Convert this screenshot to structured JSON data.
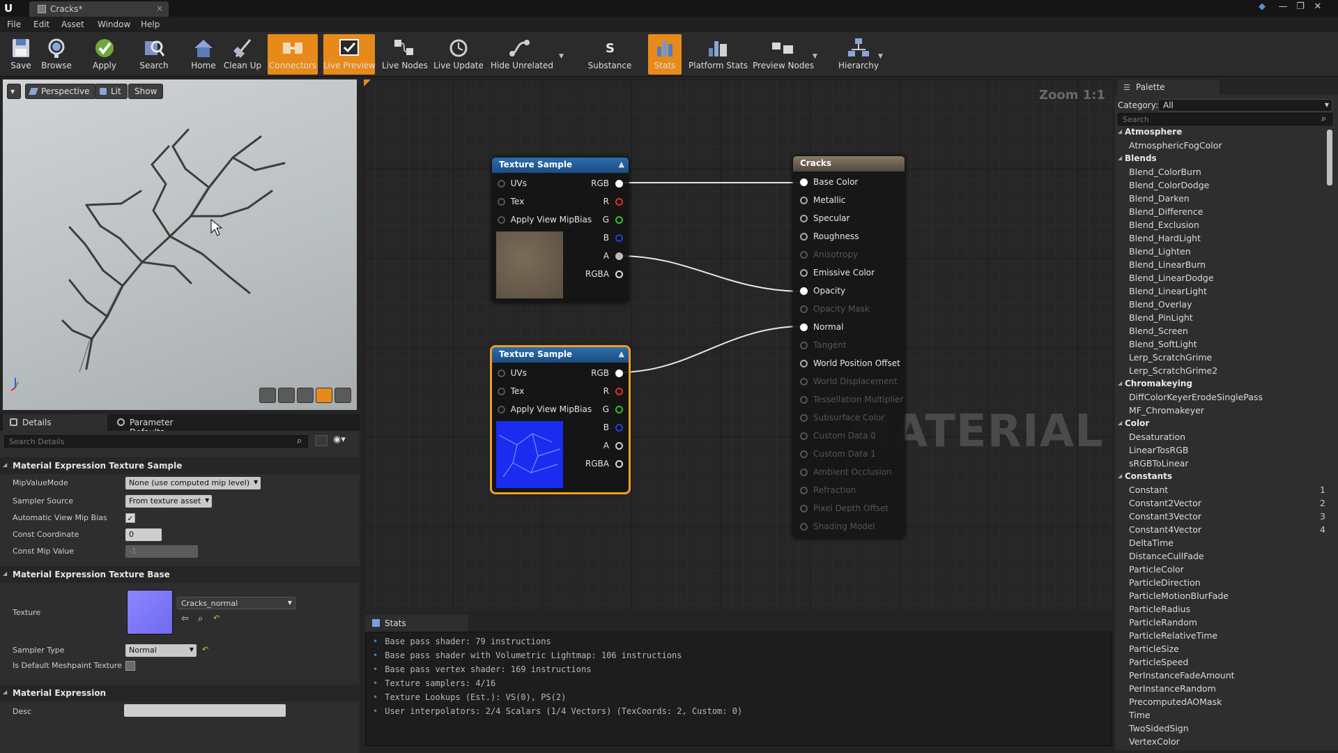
{
  "window": {
    "tab_title": "Cracks*",
    "controls": [
      "—",
      "❐",
      "✕"
    ]
  },
  "menu": [
    "File",
    "Edit",
    "Asset",
    "Window",
    "Help"
  ],
  "toolbar": [
    {
      "label": "Save",
      "icon": "save-icon",
      "active": false
    },
    {
      "label": "Browse",
      "icon": "browse-icon",
      "active": false
    },
    {
      "label": "Apply",
      "icon": "apply-icon",
      "active": false
    },
    {
      "label": "Search",
      "icon": "search-icon",
      "active": false
    },
    {
      "label": "Home",
      "icon": "home-icon",
      "active": false
    },
    {
      "label": "Clean Up",
      "icon": "clean-up-icon",
      "active": false
    },
    {
      "label": "Connectors",
      "icon": "connectors-icon",
      "active": true
    },
    {
      "label": "Live Preview",
      "icon": "live-preview-icon",
      "active": true
    },
    {
      "label": "Live Nodes",
      "icon": "live-nodes-icon",
      "active": false
    },
    {
      "label": "Live Update",
      "icon": "live-update-icon",
      "active": false
    },
    {
      "label": "Hide Unrelated",
      "icon": "hide-unrelated-icon",
      "active": false
    },
    {
      "label": "Substance",
      "icon": "substance-icon",
      "active": false
    },
    {
      "label": "Stats",
      "icon": "stats-icon",
      "active": true
    },
    {
      "label": "Platform Stats",
      "icon": "platform-stats-icon",
      "active": false
    },
    {
      "label": "Preview Nodes",
      "icon": "preview-nodes-icon",
      "active": false
    },
    {
      "label": "Hierarchy",
      "icon": "hierarchy-icon",
      "active": false
    }
  ],
  "viewport": {
    "perspective": "Perspective",
    "lit": "Lit",
    "show": "Show"
  },
  "details": {
    "tabs": [
      "Details",
      "Parameter Defaults"
    ],
    "search_placeholder": "Search Details",
    "section1": "Material Expression Texture Sample",
    "mip_value_mode_label": "MipValueMode",
    "mip_value_mode": "None (use computed mip level)",
    "sampler_source_label": "Sampler Source",
    "sampler_source": "From texture asset",
    "auto_mip_label": "Automatic View Mip Bias",
    "auto_mip_checked": true,
    "const_coord_label": "Const Coordinate",
    "const_coord": "0",
    "const_mip_label": "Const Mip Value",
    "const_mip": "-1",
    "section2": "Material Expression Texture Base",
    "texture_label": "Texture",
    "texture": "Cracks_normal",
    "sampler_type_label": "Sampler Type",
    "sampler_type": "Normal",
    "default_meshpaint_label": "Is Default Meshpaint Texture",
    "default_meshpaint_checked": false,
    "section3": "Material Expression",
    "desc_label": "Desc",
    "desc": ""
  },
  "graph": {
    "zoom": "Zoom 1:1",
    "watermark": "MATERIAL",
    "node1": {
      "title": "Texture Sample",
      "inputs": [
        "UVs",
        "Tex",
        "Apply View MipBias"
      ],
      "outputs": [
        "RGB",
        "R",
        "G",
        "B",
        "A",
        "RGBA"
      ]
    },
    "node2": {
      "title": "Texture Sample",
      "inputs": [
        "UVs",
        "Tex",
        "Apply View MipBias"
      ],
      "outputs": [
        "RGB",
        "R",
        "G",
        "B",
        "A",
        "RGBA"
      ]
    },
    "result": {
      "title": "Cracks",
      "pins": [
        {
          "label": "Base Color",
          "enabled": true,
          "connected": true
        },
        {
          "label": "Metallic",
          "enabled": true,
          "connected": false
        },
        {
          "label": "Specular",
          "enabled": true,
          "connected": false
        },
        {
          "label": "Roughness",
          "enabled": true,
          "connected": false
        },
        {
          "label": "Anisotropy",
          "enabled": false,
          "connected": false
        },
        {
          "label": "Emissive Color",
          "enabled": true,
          "connected": false
        },
        {
          "label": "Opacity",
          "enabled": true,
          "connected": true
        },
        {
          "label": "Opacity Mask",
          "enabled": false,
          "connected": false
        },
        {
          "label": "Normal",
          "enabled": true,
          "connected": true
        },
        {
          "label": "Tangent",
          "enabled": false,
          "connected": false
        },
        {
          "label": "World Position Offset",
          "enabled": true,
          "connected": false
        },
        {
          "label": "World Displacement",
          "enabled": false,
          "connected": false
        },
        {
          "label": "Tessellation Multiplier",
          "enabled": false,
          "connected": false
        },
        {
          "label": "Subsurface Color",
          "enabled": false,
          "connected": false
        },
        {
          "label": "Custom Data 0",
          "enabled": false,
          "connected": false
        },
        {
          "label": "Custom Data 1",
          "enabled": false,
          "connected": false
        },
        {
          "label": "Ambient Occlusion",
          "enabled": false,
          "connected": false
        },
        {
          "label": "Refraction",
          "enabled": false,
          "connected": false
        },
        {
          "label": "Pixel Depth Offset",
          "enabled": false,
          "connected": false
        },
        {
          "label": "Shading Model",
          "enabled": false,
          "connected": false
        }
      ]
    }
  },
  "stats": {
    "tab": "Stats",
    "lines": [
      "Base pass shader: 79 instructions",
      "Base pass shader with Volumetric Lightmap: 106 instructions",
      "Base pass vertex shader: 169 instructions",
      "Texture samplers: 4/16",
      "Texture Lookups (Est.): VS(0), PS(2)",
      "User interpolators: 2/4 Scalars (1/4 Vectors) (TexCoords: 2, Custom: 0)"
    ]
  },
  "palette": {
    "tab": "Palette",
    "category_label": "Category:",
    "category": "All",
    "search_placeholder": "Search",
    "groups": [
      {
        "name": "Atmosphere",
        "items": [
          {
            "name": "AtmosphericFogColor",
            "hotkey": ""
          }
        ]
      },
      {
        "name": "Blends",
        "items": [
          {
            "name": "Blend_ColorBurn",
            "hotkey": ""
          },
          {
            "name": "Blend_ColorDodge",
            "hotkey": ""
          },
          {
            "name": "Blend_Darken",
            "hotkey": ""
          },
          {
            "name": "Blend_Difference",
            "hotkey": ""
          },
          {
            "name": "Blend_Exclusion",
            "hotkey": ""
          },
          {
            "name": "Blend_HardLight",
            "hotkey": ""
          },
          {
            "name": "Blend_Lighten",
            "hotkey": ""
          },
          {
            "name": "Blend_LinearBurn",
            "hotkey": ""
          },
          {
            "name": "Blend_LinearDodge",
            "hotkey": ""
          },
          {
            "name": "Blend_LinearLight",
            "hotkey": ""
          },
          {
            "name": "Blend_Overlay",
            "hotkey": ""
          },
          {
            "name": "Blend_PinLight",
            "hotkey": ""
          },
          {
            "name": "Blend_Screen",
            "hotkey": ""
          },
          {
            "name": "Blend_SoftLight",
            "hotkey": ""
          },
          {
            "name": "Lerp_ScratchGrime",
            "hotkey": ""
          },
          {
            "name": "Lerp_ScratchGrime2",
            "hotkey": ""
          }
        ]
      },
      {
        "name": "Chromakeying",
        "items": [
          {
            "name": "DiffColorKeyerErodeSinglePass",
            "hotkey": ""
          },
          {
            "name": "MF_Chromakeyer",
            "hotkey": ""
          }
        ]
      },
      {
        "name": "Color",
        "items": [
          {
            "name": "Desaturation",
            "hotkey": ""
          },
          {
            "name": "LinearTosRGB",
            "hotkey": ""
          },
          {
            "name": "sRGBToLinear",
            "hotkey": ""
          }
        ]
      },
      {
        "name": "Constants",
        "items": [
          {
            "name": "Constant",
            "hotkey": "1"
          },
          {
            "name": "Constant2Vector",
            "hotkey": "2"
          },
          {
            "name": "Constant3Vector",
            "hotkey": "3"
          },
          {
            "name": "Constant4Vector",
            "hotkey": "4"
          },
          {
            "name": "DeltaTime",
            "hotkey": ""
          },
          {
            "name": "DistanceCullFade",
            "hotkey": ""
          },
          {
            "name": "ParticleColor",
            "hotkey": ""
          },
          {
            "name": "ParticleDirection",
            "hotkey": ""
          },
          {
            "name": "ParticleMotionBlurFade",
            "hotkey": ""
          },
          {
            "name": "ParticleRadius",
            "hotkey": ""
          },
          {
            "name": "ParticleRandom",
            "hotkey": ""
          },
          {
            "name": "ParticleRelativeTime",
            "hotkey": ""
          },
          {
            "name": "ParticleSize",
            "hotkey": ""
          },
          {
            "name": "ParticleSpeed",
            "hotkey": ""
          },
          {
            "name": "PerInstanceFadeAmount",
            "hotkey": ""
          },
          {
            "name": "PerInstanceRandom",
            "hotkey": ""
          },
          {
            "name": "PrecomputedAOMask",
            "hotkey": ""
          },
          {
            "name": "Time",
            "hotkey": ""
          },
          {
            "name": "TwoSidedSign",
            "hotkey": ""
          },
          {
            "name": "VertexColor",
            "hotkey": ""
          }
        ]
      }
    ]
  }
}
